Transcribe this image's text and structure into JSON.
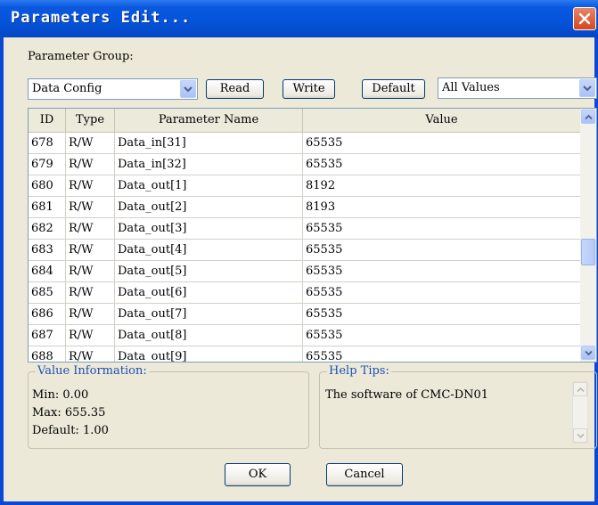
{
  "window": {
    "title": "Parameters Edit..."
  },
  "group_label": "Parameter Group:",
  "group_combo": {
    "value": "Data Config"
  },
  "buttons": {
    "read": "Read",
    "write": "Write",
    "default": "Default",
    "ok": "OK",
    "cancel": "Cancel"
  },
  "filter_combo": {
    "value": "All Values"
  },
  "table": {
    "headers": [
      "ID",
      "Type",
      "Parameter Name",
      "Value"
    ],
    "rows": [
      [
        "678",
        "R/W",
        "Data_in[31]",
        "65535"
      ],
      [
        "679",
        "R/W",
        "Data_in[32]",
        "65535"
      ],
      [
        "680",
        "R/W",
        "Data_out[1]",
        "8192"
      ],
      [
        "681",
        "R/W",
        "Data_out[2]",
        "8193"
      ],
      [
        "682",
        "R/W",
        "Data_out[3]",
        "65535"
      ],
      [
        "683",
        "R/W",
        "Data_out[4]",
        "65535"
      ],
      [
        "684",
        "R/W",
        "Data_out[5]",
        "65535"
      ],
      [
        "685",
        "R/W",
        "Data_out[6]",
        "65535"
      ],
      [
        "686",
        "R/W",
        "Data_out[7]",
        "65535"
      ],
      [
        "687",
        "R/W",
        "Data_out[8]",
        "65535"
      ],
      [
        "688",
        "R/W",
        "Data_out[9]",
        "65535"
      ]
    ]
  },
  "value_info": {
    "legend": "Value Information:",
    "min": "Min:  0.00",
    "max": "Max:  655.35",
    "default": "Default:  1.00"
  },
  "help_tips": {
    "legend": "Help Tips:",
    "text": "The software of CMC-DN01"
  }
}
